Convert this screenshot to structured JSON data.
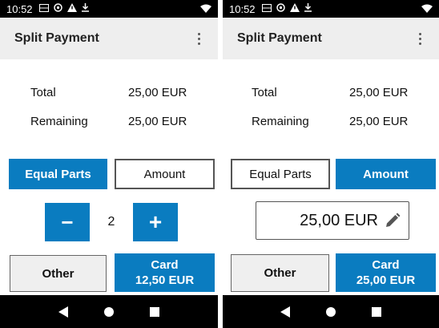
{
  "screens": [
    {
      "status": {
        "time": "10:52"
      },
      "app_bar": {
        "title": "Split Payment"
      },
      "summary": {
        "total_label": "Total",
        "total_value": "25,00 EUR",
        "remaining_label": "Remaining",
        "remaining_value": "25,00 EUR"
      },
      "mode": {
        "equal_parts": "Equal Parts",
        "amount": "Amount",
        "selected": "Equal Parts"
      },
      "stepper": {
        "minus": "−",
        "value": "2",
        "plus": "+"
      },
      "actions": {
        "other": "Other",
        "card_label": "Card",
        "card_amount": "12,50 EUR"
      }
    },
    {
      "status": {
        "time": "10:52"
      },
      "app_bar": {
        "title": "Split Payment"
      },
      "summary": {
        "total_label": "Total",
        "total_value": "25,00 EUR",
        "remaining_label": "Remaining",
        "remaining_value": "25,00 EUR"
      },
      "mode": {
        "equal_parts": "Equal Parts",
        "amount": "Amount",
        "selected": "Amount"
      },
      "amount_field": {
        "value": "25,00 EUR",
        "icon": "pencil-icon"
      },
      "actions": {
        "other": "Other",
        "card_label": "Card",
        "card_amount": "25,00 EUR"
      }
    }
  ],
  "colors": {
    "accent": "#0a7cc0",
    "app_bar": "#eeeeee",
    "status_bar": "#000000"
  },
  "icons": {
    "status": [
      "battery-saver-icon",
      "do-not-disturb-icon",
      "warning-icon",
      "download-icon",
      "wifi-icon"
    ],
    "nav": [
      "back-icon",
      "home-icon",
      "recents-icon"
    ]
  }
}
